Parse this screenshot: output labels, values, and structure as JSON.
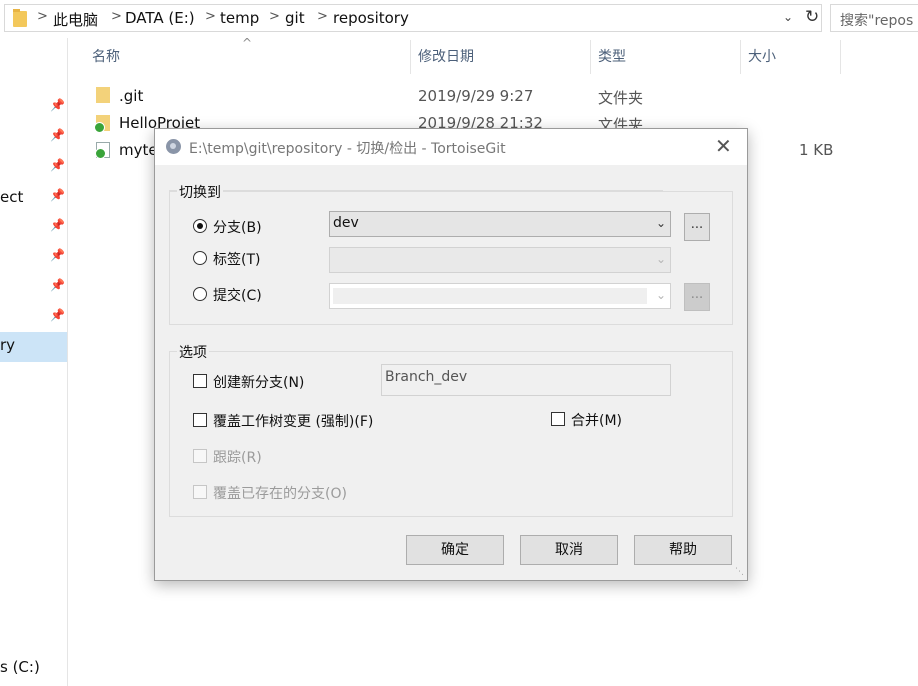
{
  "explorer": {
    "breadcrumbs": [
      "此电脑",
      "DATA (E:)",
      "temp",
      "git",
      "repository"
    ],
    "search_placeholder": "搜索\"repos",
    "nav": {
      "items": [
        "ect",
        "ry",
        "s (C:)"
      ]
    },
    "columns": {
      "name": "名称",
      "date": "修改日期",
      "type": "类型",
      "size": "大小"
    },
    "files": [
      {
        "name": ".git",
        "date": "2019/9/29 9:27",
        "type": "文件夹",
        "size": ""
      },
      {
        "name": "HelloProjet",
        "date": "2019/9/28 21:32",
        "type": "文件夹",
        "size": ""
      },
      {
        "name": "myte",
        "date": "",
        "type": "",
        "size": "1 KB"
      }
    ]
  },
  "dialog": {
    "title": "E:\\temp\\git\\repository - 切换/检出 - TortoiseGit",
    "switch_to": {
      "label": "切换到",
      "branch_label": "分支(B)",
      "branch_value": "dev",
      "tag_label": "标签(T)",
      "commit_label": "提交(C)",
      "dots": "..."
    },
    "options": {
      "label": "选项",
      "create_branch": "创建新分支(N)",
      "new_branch_name": "Branch_dev",
      "override_changes": "覆盖工作树变更 (强制)(F)",
      "merge": "合并(M)",
      "track": "跟踪(R)",
      "override_branch": "覆盖已存在的分支(O)"
    },
    "buttons": {
      "ok": "确定",
      "cancel": "取消",
      "help": "帮助"
    }
  }
}
